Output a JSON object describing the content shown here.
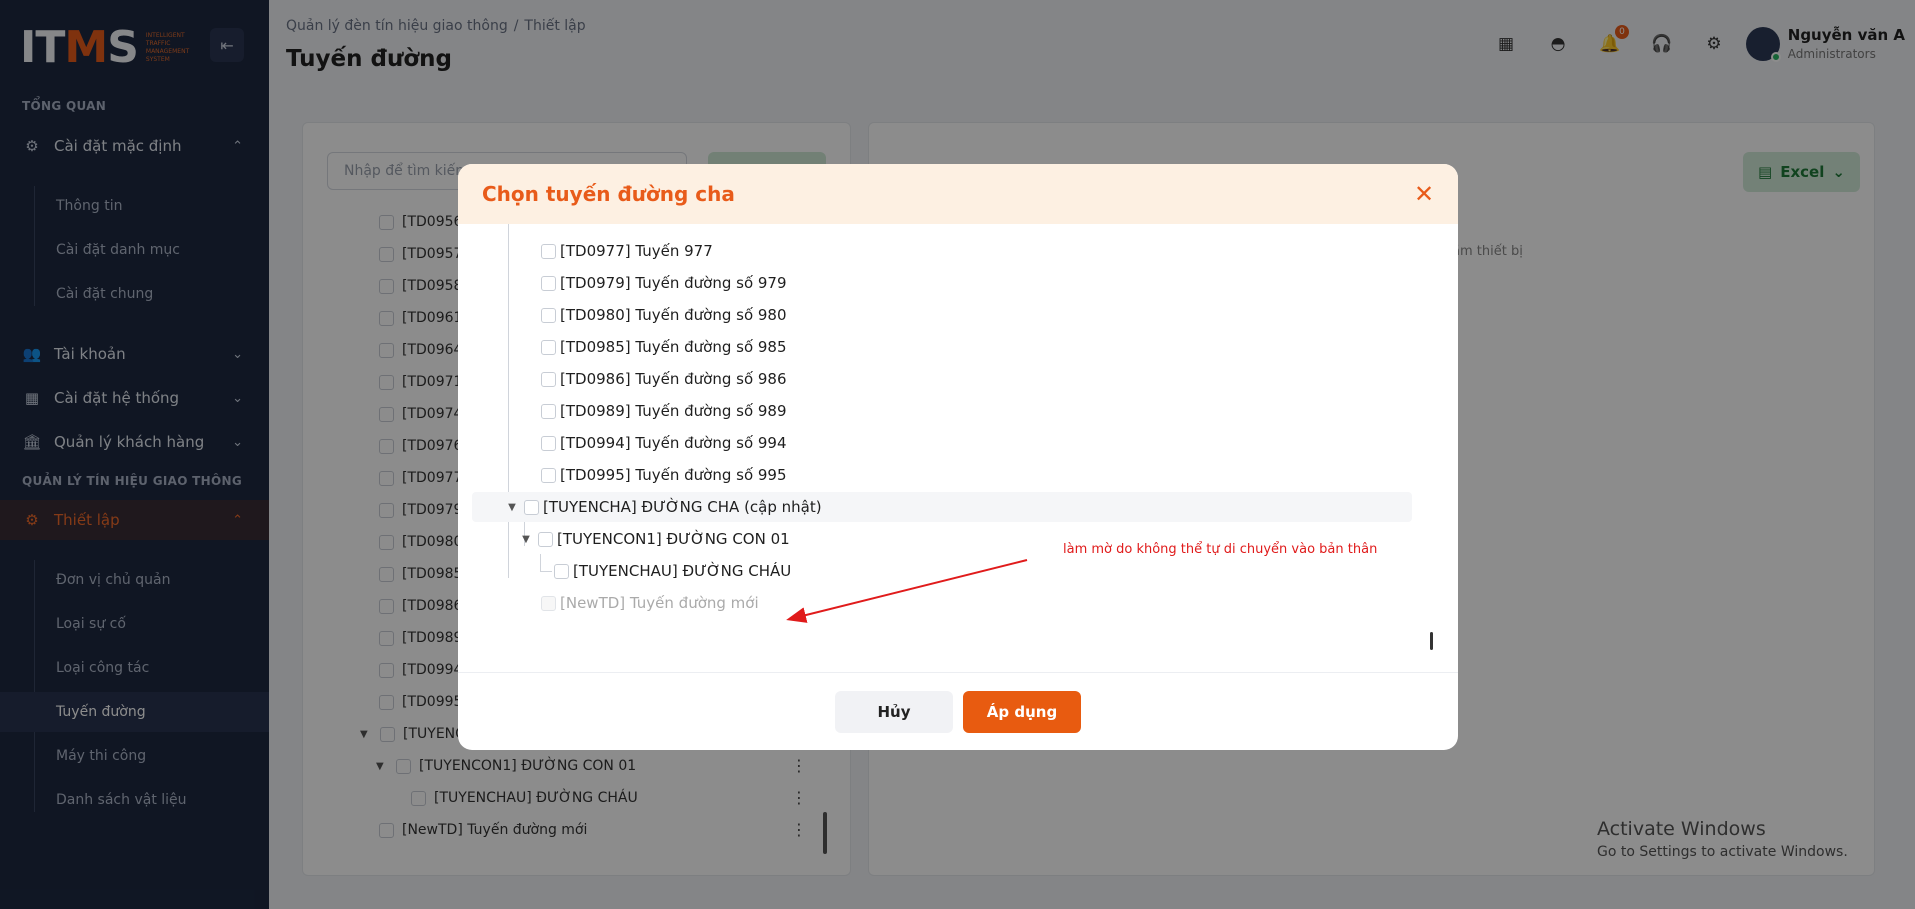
{
  "app": {
    "logo_text": "ITMS",
    "logo_subtitle": "INTELLIGENT TRAFFIC MANAGEMENT SYSTEM"
  },
  "sidebar": {
    "section_overview": "TỔNG QUAN",
    "section_traffic": "QUẢN LÝ TÍN HIỆU GIAO THÔNG",
    "group_default": "Cài đặt mặc định",
    "default_items": [
      "Thông tin",
      "Cài đặt danh mục",
      "Cài đặt chung"
    ],
    "accounts": "Tài khoản",
    "system_settings": "Cài đặt hệ thống",
    "customer_mgmt": "Quản lý khách hàng",
    "setup": "Thiết lập",
    "setup_items": [
      "Đơn vị chủ quản",
      "Loại sự cố",
      "Loại công tác",
      "Tuyến đường",
      "Máy thi công",
      "Danh sách vật liệu"
    ]
  },
  "header": {
    "breadcrumb_1": "Quản lý đèn tín hiệu giao thông",
    "breadcrumb_2": "Thiết lập",
    "title": "Tuyến đường",
    "notification_count": "0",
    "user_name": "Nguyễn văn A",
    "user_role": "Administrators"
  },
  "background": {
    "search_placeholder": "Nhập để tìm kiếm",
    "excel_label": "Excel",
    "right_hint": "ầm thiết bị",
    "rows": [
      "[TD0956",
      "[TD0957",
      "[TD0958",
      "[TD0961",
      "[TD0964",
      "[TD0971",
      "[TD0974",
      "[TD0976",
      "[TD0977",
      "[TD0979",
      "[TD0980",
      "[TD0985",
      "[TD0986",
      "[TD0989",
      "[TD0994",
      "[TD0995",
      "[TUYENC"
    ],
    "row_child": "[TUYENCON1] ĐƯỜNG CON 01",
    "row_grandchild": "[TUYENCHAU] ĐƯỜNG CHÁU",
    "row_new": "[NewTD] Tuyến đường mới"
  },
  "modal": {
    "title": "Chọn tuyến đường cha",
    "items": [
      "[TD0977] Tuyến 977",
      "[TD0979] Tuyến đường số 979",
      "[TD0980] Tuyến đường số 980",
      "[TD0985] Tuyến đường số 985",
      "[TD0986] Tuyến đường số 986",
      "[TD0989] Tuyến đường số 989",
      "[TD0994] Tuyến đường số 994",
      "[TD0995] Tuyến đường số 995"
    ],
    "parent": "[TUYENCHA] ĐƯỜNG CHA (cập nhật)",
    "child": "[TUYENCON1] ĐƯỜNG CON 01",
    "grandchild": "[TUYENCHAU] ĐƯỜNG CHÁU",
    "new_item": "[NewTD] Tuyến đường mới",
    "cancel": "Hủy",
    "apply": "Áp dụng"
  },
  "annotation": "làm mờ do không thể tự di chuyển vào bản thân",
  "windows": {
    "line1": "Activate Windows",
    "line2": "Go to Settings to activate Windows."
  },
  "colors": {
    "accent": "#e85b1a",
    "sidebar_bg": "#1e2941"
  }
}
